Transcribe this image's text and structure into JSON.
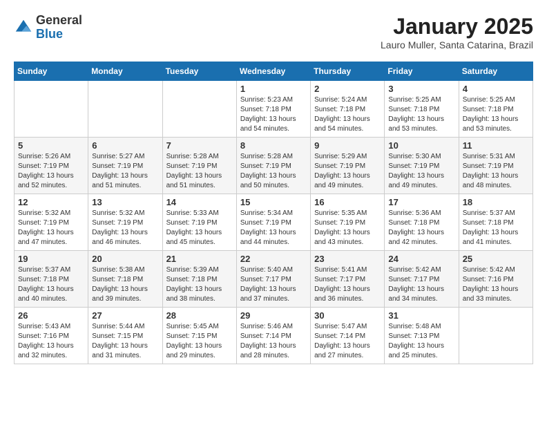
{
  "logo": {
    "general": "General",
    "blue": "Blue"
  },
  "title": "January 2025",
  "subtitle": "Lauro Muller, Santa Catarina, Brazil",
  "weekdays": [
    "Sunday",
    "Monday",
    "Tuesday",
    "Wednesday",
    "Thursday",
    "Friday",
    "Saturday"
  ],
  "weeks": [
    [
      {
        "day": "",
        "info": ""
      },
      {
        "day": "",
        "info": ""
      },
      {
        "day": "",
        "info": ""
      },
      {
        "day": "1",
        "info": "Sunrise: 5:23 AM\nSunset: 7:18 PM\nDaylight: 13 hours\nand 54 minutes."
      },
      {
        "day": "2",
        "info": "Sunrise: 5:24 AM\nSunset: 7:18 PM\nDaylight: 13 hours\nand 54 minutes."
      },
      {
        "day": "3",
        "info": "Sunrise: 5:25 AM\nSunset: 7:18 PM\nDaylight: 13 hours\nand 53 minutes."
      },
      {
        "day": "4",
        "info": "Sunrise: 5:25 AM\nSunset: 7:18 PM\nDaylight: 13 hours\nand 53 minutes."
      }
    ],
    [
      {
        "day": "5",
        "info": "Sunrise: 5:26 AM\nSunset: 7:19 PM\nDaylight: 13 hours\nand 52 minutes."
      },
      {
        "day": "6",
        "info": "Sunrise: 5:27 AM\nSunset: 7:19 PM\nDaylight: 13 hours\nand 51 minutes."
      },
      {
        "day": "7",
        "info": "Sunrise: 5:28 AM\nSunset: 7:19 PM\nDaylight: 13 hours\nand 51 minutes."
      },
      {
        "day": "8",
        "info": "Sunrise: 5:28 AM\nSunset: 7:19 PM\nDaylight: 13 hours\nand 50 minutes."
      },
      {
        "day": "9",
        "info": "Sunrise: 5:29 AM\nSunset: 7:19 PM\nDaylight: 13 hours\nand 49 minutes."
      },
      {
        "day": "10",
        "info": "Sunrise: 5:30 AM\nSunset: 7:19 PM\nDaylight: 13 hours\nand 49 minutes."
      },
      {
        "day": "11",
        "info": "Sunrise: 5:31 AM\nSunset: 7:19 PM\nDaylight: 13 hours\nand 48 minutes."
      }
    ],
    [
      {
        "day": "12",
        "info": "Sunrise: 5:32 AM\nSunset: 7:19 PM\nDaylight: 13 hours\nand 47 minutes."
      },
      {
        "day": "13",
        "info": "Sunrise: 5:32 AM\nSunset: 7:19 PM\nDaylight: 13 hours\nand 46 minutes."
      },
      {
        "day": "14",
        "info": "Sunrise: 5:33 AM\nSunset: 7:19 PM\nDaylight: 13 hours\nand 45 minutes."
      },
      {
        "day": "15",
        "info": "Sunrise: 5:34 AM\nSunset: 7:19 PM\nDaylight: 13 hours\nand 44 minutes."
      },
      {
        "day": "16",
        "info": "Sunrise: 5:35 AM\nSunset: 7:19 PM\nDaylight: 13 hours\nand 43 minutes."
      },
      {
        "day": "17",
        "info": "Sunrise: 5:36 AM\nSunset: 7:18 PM\nDaylight: 13 hours\nand 42 minutes."
      },
      {
        "day": "18",
        "info": "Sunrise: 5:37 AM\nSunset: 7:18 PM\nDaylight: 13 hours\nand 41 minutes."
      }
    ],
    [
      {
        "day": "19",
        "info": "Sunrise: 5:37 AM\nSunset: 7:18 PM\nDaylight: 13 hours\nand 40 minutes."
      },
      {
        "day": "20",
        "info": "Sunrise: 5:38 AM\nSunset: 7:18 PM\nDaylight: 13 hours\nand 39 minutes."
      },
      {
        "day": "21",
        "info": "Sunrise: 5:39 AM\nSunset: 7:18 PM\nDaylight: 13 hours\nand 38 minutes."
      },
      {
        "day": "22",
        "info": "Sunrise: 5:40 AM\nSunset: 7:17 PM\nDaylight: 13 hours\nand 37 minutes."
      },
      {
        "day": "23",
        "info": "Sunrise: 5:41 AM\nSunset: 7:17 PM\nDaylight: 13 hours\nand 36 minutes."
      },
      {
        "day": "24",
        "info": "Sunrise: 5:42 AM\nSunset: 7:17 PM\nDaylight: 13 hours\nand 34 minutes."
      },
      {
        "day": "25",
        "info": "Sunrise: 5:42 AM\nSunset: 7:16 PM\nDaylight: 13 hours\nand 33 minutes."
      }
    ],
    [
      {
        "day": "26",
        "info": "Sunrise: 5:43 AM\nSunset: 7:16 PM\nDaylight: 13 hours\nand 32 minutes."
      },
      {
        "day": "27",
        "info": "Sunrise: 5:44 AM\nSunset: 7:15 PM\nDaylight: 13 hours\nand 31 minutes."
      },
      {
        "day": "28",
        "info": "Sunrise: 5:45 AM\nSunset: 7:15 PM\nDaylight: 13 hours\nand 29 minutes."
      },
      {
        "day": "29",
        "info": "Sunrise: 5:46 AM\nSunset: 7:14 PM\nDaylight: 13 hours\nand 28 minutes."
      },
      {
        "day": "30",
        "info": "Sunrise: 5:47 AM\nSunset: 7:14 PM\nDaylight: 13 hours\nand 27 minutes."
      },
      {
        "day": "31",
        "info": "Sunrise: 5:48 AM\nSunset: 7:13 PM\nDaylight: 13 hours\nand 25 minutes."
      },
      {
        "day": "",
        "info": ""
      }
    ]
  ]
}
